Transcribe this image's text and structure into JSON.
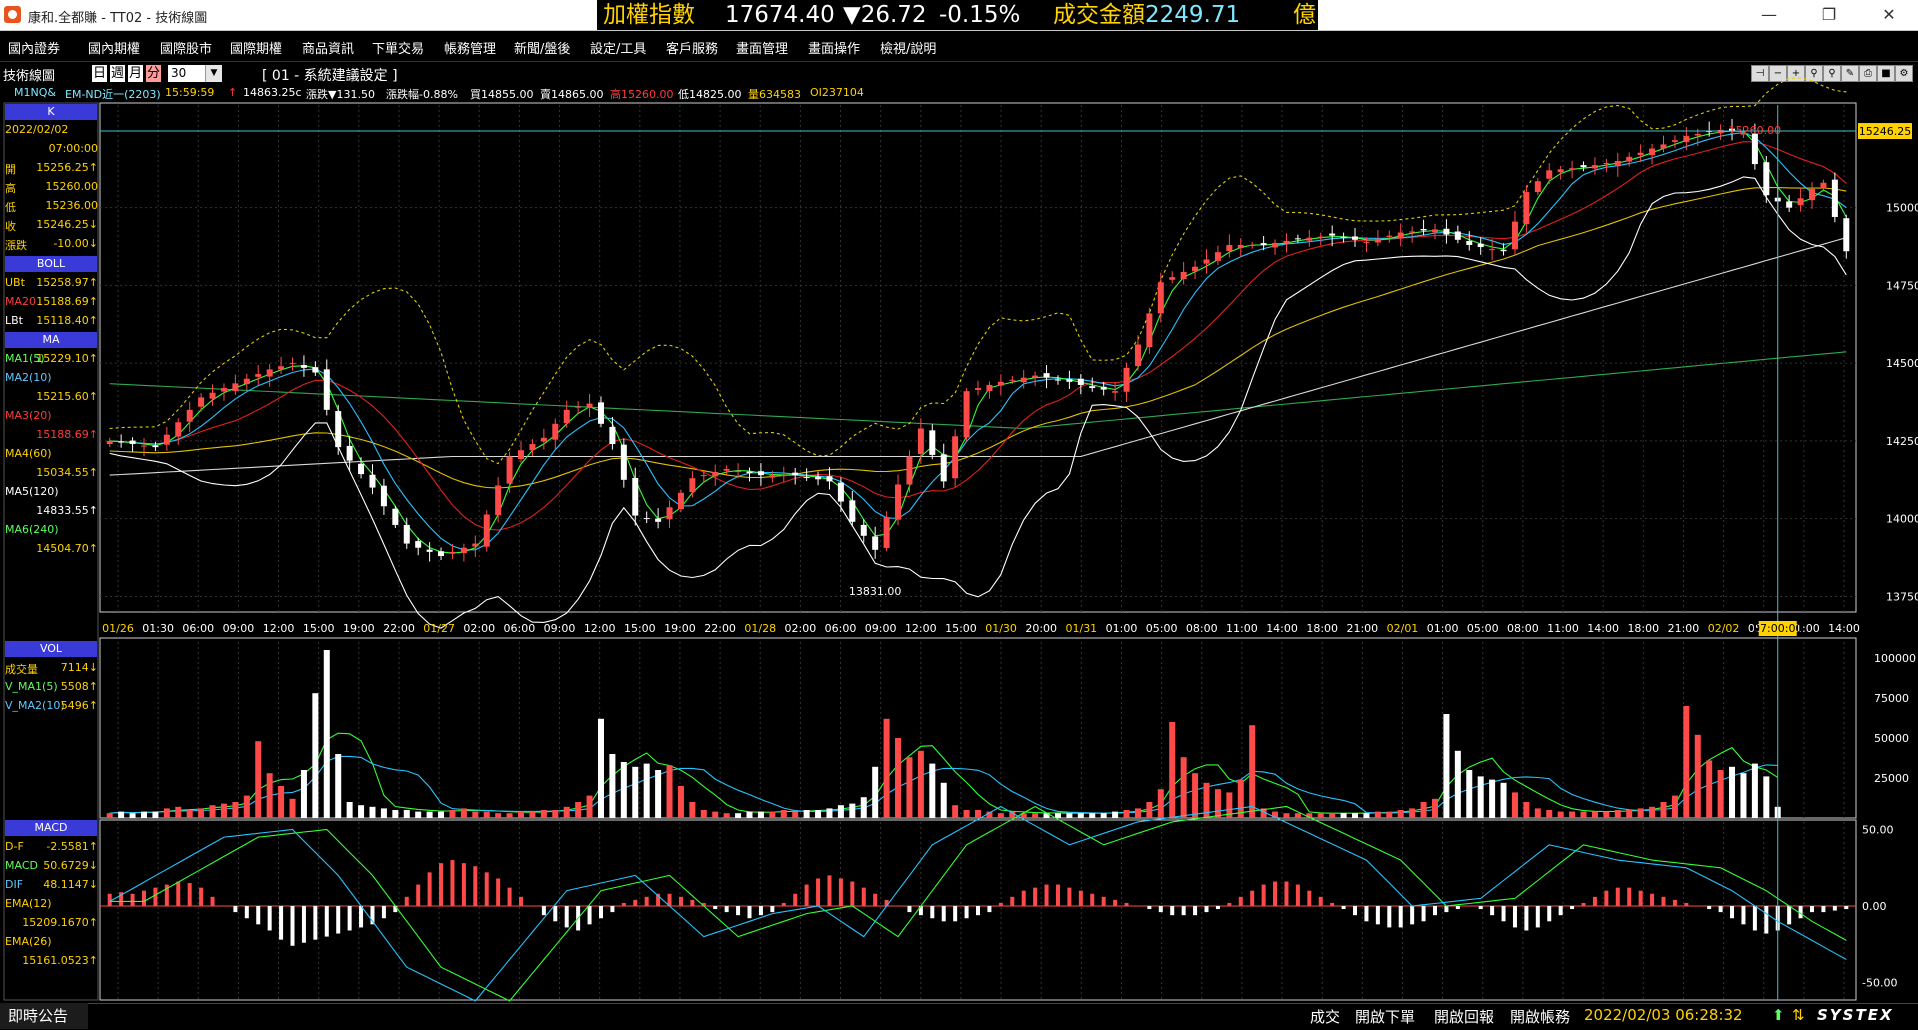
{
  "window": {
    "title": "康和.全都賺 - TT02 - 技術線圖"
  },
  "ticker": {
    "name": "加權指數",
    "price": "17674.40",
    "change": "▼26.72",
    "pct": "-0.15%",
    "vol_label": "成交金額",
    "vol_value": "2249.71",
    "unit": "億"
  },
  "menu": [
    "國內證券",
    "國內期權",
    "國際股市",
    "國際期權",
    "商品資訊",
    "下單交易",
    "帳務管理",
    "新聞/盤後",
    "設定/工具",
    "客戶服務",
    "畫面管理",
    "畫面操作",
    "檢視/說明"
  ],
  "toolbar": {
    "label": "技術線圖",
    "periods": [
      "日",
      "週",
      "月",
      "分"
    ],
    "interval": "30",
    "setting": "[ 01 - 系統建議設定 ]"
  },
  "quote": {
    "symbol": "M1NQ&",
    "name": "EM-ND近一(2203)",
    "time": "15:59:59",
    "last": "14863.25c",
    "change": "漲跌▼131.50",
    "pct": "漲跌幅-0.88%",
    "bid": "買14855.00",
    "ask": "賣14865.00",
    "high": "高15260.00",
    "low": "低14825.00",
    "volume": "量634583",
    "oi": "OI237104"
  },
  "side": {
    "k_header": "K",
    "date": "2022/02/02",
    "time": "07:00:00",
    "k": [
      {
        "label": "開",
        "value": "15256.25↑"
      },
      {
        "label": "高",
        "value": "15260.00"
      },
      {
        "label": "低",
        "value": "15236.00"
      },
      {
        "label": "收",
        "value": "15246.25↓"
      },
      {
        "label": "漲跌",
        "value": "-10.00↓"
      }
    ],
    "boll_header": "BOLL",
    "boll": [
      {
        "label": "UBt",
        "value": "15258.97↑"
      },
      {
        "label": "MA20",
        "value": "15188.69↑"
      },
      {
        "label": "LBt",
        "value": "15118.40↑"
      }
    ],
    "ma_header": "MA",
    "ma": [
      {
        "label": "MA1(5)",
        "value": "15229.10↑"
      },
      {
        "label": "MA2(10)",
        "value": "15215.60↑"
      },
      {
        "label": "MA3(20)",
        "value": "15188.69↑"
      },
      {
        "label": "MA4(60)",
        "value": "15034.55↑"
      },
      {
        "label": "MA5(120)",
        "value": "14833.55↑"
      },
      {
        "label": "MA6(240)",
        "value": "14504.70↑"
      }
    ],
    "vol_header": "VOL",
    "vol": [
      {
        "label": "成交量",
        "value": "7114↓"
      },
      {
        "label": "V_MA1(5)",
        "value": "5508↑"
      },
      {
        "label": "V_MA2(10)",
        "value": "5496↑"
      }
    ],
    "macd_header": "MACD",
    "macd": [
      {
        "label": "D-F",
        "value": "-2.5581↑"
      },
      {
        "label": "MACD",
        "value": "50.6729↓"
      },
      {
        "label": "DIF",
        "value": "48.1147↓"
      },
      {
        "label": "EMA(12)",
        "value": ""
      },
      {
        "label": "",
        "value": "15209.1670↑"
      },
      {
        "label": "EMA(26)",
        "value": ""
      },
      {
        "label": "",
        "value": "15161.0523↑"
      }
    ]
  },
  "chart_data": {
    "type": "candlestick",
    "price_ticks": [
      "15000.00",
      "14750.00",
      "14500.00",
      "14250.00",
      "14000.00",
      "13750.00"
    ],
    "current_price": "15246.25",
    "high_label": "15260.00",
    "low_label": "13831.00",
    "cursor_time": "07:00:00",
    "time_labels": [
      {
        "t": "01/26",
        "date": true
      },
      {
        "t": "01:30"
      },
      {
        "t": "06:00"
      },
      {
        "t": "09:00"
      },
      {
        "t": "12:00"
      },
      {
        "t": "15:00"
      },
      {
        "t": "19:00"
      },
      {
        "t": "22:00"
      },
      {
        "t": "01/27",
        "date": true
      },
      {
        "t": "02:00"
      },
      {
        "t": "06:00"
      },
      {
        "t": "09:00"
      },
      {
        "t": "12:00"
      },
      {
        "t": "15:00"
      },
      {
        "t": "19:00"
      },
      {
        "t": "22:00"
      },
      {
        "t": "01/28",
        "date": true
      },
      {
        "t": "02:00"
      },
      {
        "t": "06:00"
      },
      {
        "t": "09:00"
      },
      {
        "t": "12:00"
      },
      {
        "t": "15:00"
      },
      {
        "t": "01/30",
        "date": true
      },
      {
        "t": "20:00"
      },
      {
        "t": "01/31",
        "date": true
      },
      {
        "t": "01:00"
      },
      {
        "t": "05:00"
      },
      {
        "t": "08:00"
      },
      {
        "t": "11:00"
      },
      {
        "t": "14:00"
      },
      {
        "t": "18:00"
      },
      {
        "t": "21:00"
      },
      {
        "t": "02/01",
        "date": true
      },
      {
        "t": "01:00"
      },
      {
        "t": "05:00"
      },
      {
        "t": "08:00"
      },
      {
        "t": "11:00"
      },
      {
        "t": "14:00"
      },
      {
        "t": "18:00"
      },
      {
        "t": "21:00"
      },
      {
        "t": "02/02",
        "date": true
      },
      {
        "t": "05:00"
      },
      {
        "t": "11:00"
      },
      {
        "t": "14:00"
      }
    ],
    "close_path": [
      [
        0,
        14250
      ],
      [
        4,
        14230
      ],
      [
        8,
        14390
      ],
      [
        12,
        14450
      ],
      [
        14,
        14480
      ],
      [
        16,
        14500
      ],
      [
        18,
        14470
      ],
      [
        20,
        14230
      ],
      [
        23,
        14100
      ],
      [
        26,
        13920
      ],
      [
        29,
        13880
      ],
      [
        32,
        13920
      ],
      [
        35,
        14200
      ],
      [
        38,
        14260
      ],
      [
        40,
        14350
      ],
      [
        42,
        14370
      ],
      [
        44,
        14240
      ],
      [
        46,
        14010
      ],
      [
        48,
        13990
      ],
      [
        51,
        14130
      ],
      [
        54,
        14160
      ],
      [
        57,
        14140
      ],
      [
        60,
        14140
      ],
      [
        63,
        14120
      ],
      [
        65,
        13990
      ],
      [
        67,
        13900
      ],
      [
        69,
        14110
      ],
      [
        71,
        14290
      ],
      [
        73,
        14120
      ],
      [
        75,
        14410
      ],
      [
        78,
        14440
      ],
      [
        81,
        14460
      ],
      [
        84,
        14440
      ],
      [
        86,
        14420
      ],
      [
        88,
        14410
      ],
      [
        90,
        14560
      ],
      [
        92,
        14760
      ],
      [
        95,
        14810
      ],
      [
        98,
        14880
      ],
      [
        101,
        14880
      ],
      [
        104,
        14900
      ],
      [
        107,
        14910
      ],
      [
        110,
        14890
      ],
      [
        113,
        14920
      ],
      [
        116,
        14930
      ],
      [
        119,
        14880
      ],
      [
        122,
        14860
      ],
      [
        124,
        15050
      ],
      [
        126,
        15120
      ],
      [
        129,
        15130
      ],
      [
        132,
        15150
      ],
      [
        135,
        15190
      ],
      [
        138,
        15230
      ],
      [
        141,
        15250
      ],
      [
        143,
        15240
      ],
      [
        145,
        15040
      ],
      [
        147,
        15000
      ],
      [
        149,
        15060
      ],
      [
        150,
        15080
      ],
      [
        152,
        14860
      ]
    ],
    "volume_ticks": [
      "100000",
      "75000",
      "50000",
      "25000"
    ],
    "volume": [
      3,
      4,
      3,
      4,
      4,
      6,
      7,
      5,
      6,
      8,
      9,
      10,
      14,
      48,
      28,
      20,
      12,
      30,
      78,
      105,
      40,
      10,
      8,
      7,
      6,
      5,
      5,
      4,
      4,
      4,
      5,
      6,
      4,
      4,
      3,
      3,
      4,
      4,
      5,
      5,
      7,
      10,
      14,
      62,
      40,
      35,
      32,
      34,
      30,
      33,
      20,
      10,
      5,
      4,
      3,
      3,
      4,
      4,
      4,
      5,
      4,
      5,
      5,
      6,
      8,
      9,
      13,
      32,
      62,
      50,
      38,
      42,
      34,
      22,
      8,
      5,
      5,
      4,
      3,
      4,
      3,
      3,
      3,
      3,
      3,
      3,
      3,
      3,
      4,
      5,
      6,
      10,
      18,
      60,
      38,
      28,
      22,
      18,
      16,
      24,
      58,
      6,
      4,
      3,
      3,
      3,
      3,
      3,
      3,
      3,
      3,
      4,
      4,
      5,
      6,
      10,
      12,
      65,
      42,
      30,
      26,
      24,
      22,
      16,
      10,
      6,
      5,
      4,
      4,
      4,
      4,
      4,
      5,
      5,
      6,
      7,
      10,
      14,
      70,
      52,
      36,
      30,
      32,
      28,
      34,
      26,
      7
    ],
    "macd_ticks": [
      "50.00",
      "0.00",
      "-50.00"
    ],
    "macd_hist": [
      8,
      9,
      8,
      10,
      12,
      14,
      16,
      15,
      12,
      6,
      0,
      -4,
      -8,
      -12,
      -16,
      -22,
      -26,
      -24,
      -22,
      -20,
      -18,
      -16,
      -14,
      -12,
      -8,
      -4,
      6,
      14,
      22,
      28,
      30,
      28,
      26,
      22,
      18,
      12,
      6,
      0,
      -6,
      -10,
      -14,
      -16,
      -12,
      -8,
      -4,
      2,
      4,
      6,
      8,
      8,
      6,
      4,
      2,
      -2,
      -4,
      -6,
      -8,
      -6,
      -4,
      2,
      8,
      14,
      18,
      20,
      18,
      16,
      12,
      8,
      4,
      0,
      -4,
      -6,
      -8,
      -10,
      -10,
      -8,
      -6,
      -4,
      2,
      6,
      10,
      12,
      14,
      14,
      12,
      10,
      8,
      6,
      4,
      2,
      0,
      -2,
      -4,
      -6,
      -6,
      -6,
      -4,
      -2,
      2,
      6,
      10,
      14,
      16,
      16,
      14,
      10,
      6,
      2,
      -2,
      -6,
      -10,
      -12,
      -14,
      -14,
      -12,
      -10,
      -6,
      -4,
      -2,
      0,
      -2,
      -6,
      -10,
      -14,
      -16,
      -14,
      -10,
      -6,
      -2,
      2,
      6,
      10,
      12,
      12,
      10,
      8,
      6,
      4,
      2,
      0,
      -2,
      -4,
      -8,
      -12,
      -16,
      -18,
      -16,
      -12,
      -8,
      -4,
      -4,
      -3,
      -2
    ],
    "macd_line": [
      [
        0,
        3
      ],
      [
        10,
        45
      ],
      [
        16,
        50
      ],
      [
        20,
        20
      ],
      [
        26,
        -40
      ],
      [
        32,
        -62
      ],
      [
        40,
        10
      ],
      [
        46,
        20
      ],
      [
        52,
        -20
      ],
      [
        58,
        -5
      ],
      [
        62,
        0
      ],
      [
        66,
        -20
      ],
      [
        72,
        40
      ],
      [
        78,
        65
      ],
      [
        84,
        40
      ],
      [
        90,
        55
      ],
      [
        100,
        65
      ],
      [
        110,
        30
      ],
      [
        114,
        0
      ],
      [
        120,
        5
      ],
      [
        126,
        40
      ],
      [
        132,
        30
      ],
      [
        138,
        25
      ],
      [
        142,
        10
      ],
      [
        146,
        -10
      ],
      [
        152,
        -35
      ]
    ]
  }
}
